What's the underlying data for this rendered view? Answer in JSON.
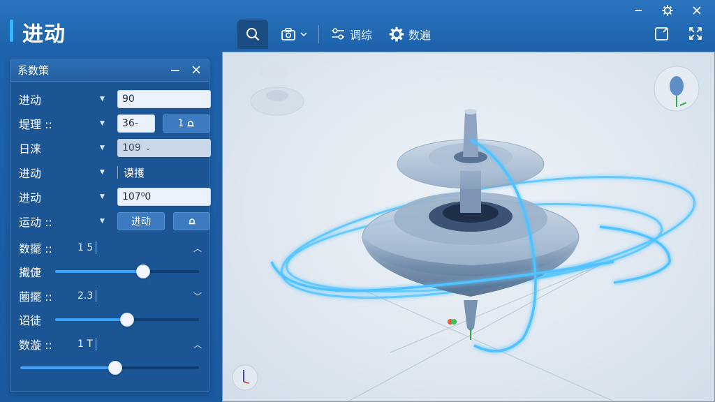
{
  "app": {
    "title": "进动"
  },
  "window_controls": {
    "minimize": "—",
    "settings": "⚙",
    "close": "✕"
  },
  "toolbar": {
    "search_icon": "search-icon",
    "camera_icon": "camera-icon",
    "filter_label": "调综",
    "settings_label": "数遍",
    "right_icons": [
      "edit-icon",
      "fullscreen-icon"
    ]
  },
  "panel": {
    "title": "系数策",
    "rows": [
      {
        "label": "进动",
        "value": "90"
      },
      {
        "label": "堤理 ::",
        "value": "36-",
        "button": "1"
      },
      {
        "label": "日涞",
        "value": "109"
      },
      {
        "label": "进动",
        "value": "谟擭"
      },
      {
        "label": "进动",
        "value": "107⁰0"
      },
      {
        "label": "运动 ::",
        "button_left": "进动",
        "button_right": ""
      }
    ],
    "groups": [
      {
        "label": "数擺 ::",
        "value": "1 5",
        "expanded": true
      },
      {
        "label": "擮倢",
        "slider": 0.61
      },
      {
        "label": "蔨擺 ::",
        "value": "2.3",
        "expanded": false
      },
      {
        "label": "诏徒",
        "slider": 0.5
      },
      {
        "label": "数漩 ::",
        "value": "1 T",
        "expanded": true
      },
      {
        "label": "",
        "slider": 0.53
      }
    ]
  },
  "colors": {
    "accent": "#39b4ff",
    "panel": "#1c5594",
    "orbit": "#4fc3ff"
  }
}
